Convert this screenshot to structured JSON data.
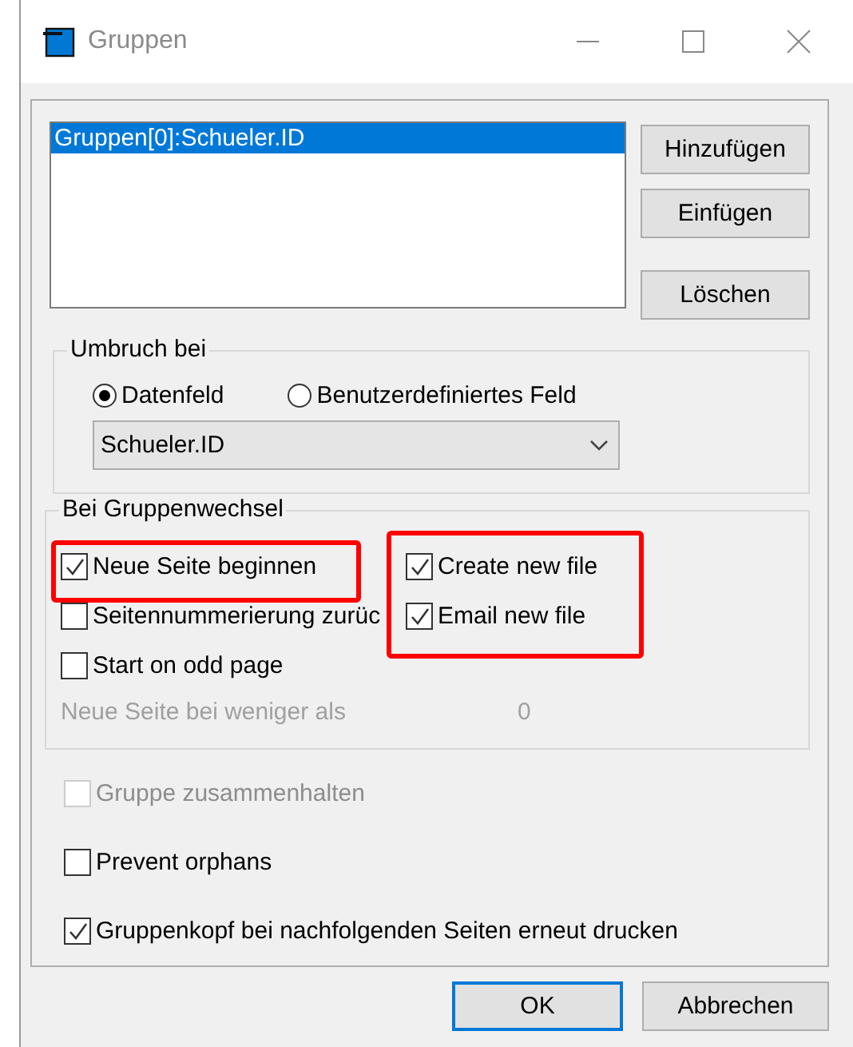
{
  "window": {
    "title": "Gruppen"
  },
  "groups_list": {
    "items": [
      {
        "label": "Gruppen[0]:Schueler.ID",
        "selected": true
      }
    ]
  },
  "side_buttons": [
    "Hinzufügen",
    "Einfügen",
    "Löschen"
  ],
  "break_section": {
    "title": "Umbruch bei",
    "radios": [
      {
        "label": "Datenfeld",
        "selected": true
      },
      {
        "label": "Benutzerdefiniertes Feld",
        "selected": false
      }
    ],
    "field": {
      "value": "Schueler.ID"
    }
  },
  "change_section": {
    "title": "Bei Gruppenwechsel",
    "left_options": [
      {
        "label": "Neue Seite beginnen",
        "checked": true,
        "highlighted": true
      },
      {
        "label": "Seitennummerierung zurüc",
        "checked": false,
        "highlighted": false
      },
      {
        "label": "Start on odd page",
        "checked": false,
        "highlighted": false
      }
    ],
    "right_options": {
      "highlighted": true,
      "items": [
        {
          "label": "Create new file",
          "checked": true
        },
        {
          "label": "Email new file",
          "checked": true
        }
      ]
    },
    "min_lines": {
      "label": "Neue Seite bei weniger als",
      "value": "0",
      "disabled": true
    }
  },
  "options": [
    {
      "label": "Gruppe zusammenhalten",
      "checked": false,
      "disabled": true
    },
    {
      "label": "Prevent orphans",
      "checked": false,
      "disabled": false
    },
    {
      "label": "Gruppenkopf bei nachfolgenden Seiten erneut drucken",
      "checked": true,
      "disabled": false
    }
  ],
  "buttons": [
    {
      "label": "OK",
      "default": true
    },
    {
      "label": "Abbrechen",
      "default": false
    }
  ]
}
